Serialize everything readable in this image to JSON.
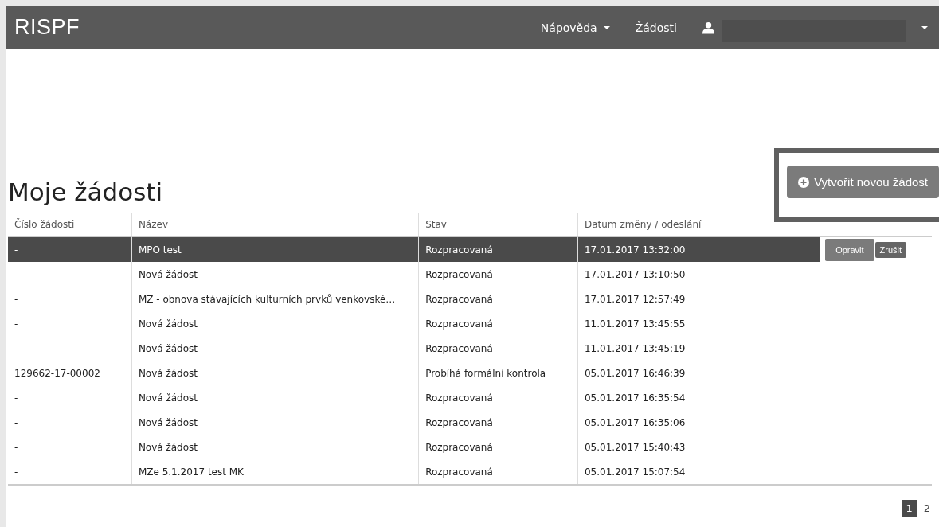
{
  "navbar": {
    "brand": "RISPF",
    "menu": [
      {
        "label": "Nápověda",
        "dropdown": true
      },
      {
        "label": "Žádosti",
        "dropdown": false
      }
    ],
    "user": {
      "redacted": true
    }
  },
  "page_title": "Moje žádosti",
  "create_button": "Vytvořit novou žádost",
  "table": {
    "columns": [
      "Číslo žádosti",
      "Název",
      "Stav",
      "Datum změny / odeslání"
    ],
    "rows": [
      {
        "number": "-",
        "name": "MPO test",
        "status": "Rozpracovaná",
        "date": "17.01.2017 13:32:00",
        "selected": true,
        "actions": [
          "Opravit",
          "Zrušit"
        ]
      },
      {
        "number": "-",
        "name": "Nová žádost",
        "status": "Rozpracovaná",
        "date": "17.01.2017 13:10:50",
        "selected": false
      },
      {
        "number": "-",
        "name": "MZ - obnova stávajících kulturních prvků venkovské…",
        "status": "Rozpracovaná",
        "date": "17.01.2017 12:57:49",
        "selected": false
      },
      {
        "number": "-",
        "name": "Nová žádost",
        "status": "Rozpracovaná",
        "date": "11.01.2017 13:45:55",
        "selected": false
      },
      {
        "number": "-",
        "name": "Nová žádost",
        "status": "Rozpracovaná",
        "date": "11.01.2017 13:45:19",
        "selected": false
      },
      {
        "number": "129662-17-00002",
        "name": "Nová žádost",
        "status": "Probíhá formální kontrola",
        "date": "05.01.2017 16:46:39",
        "selected": false
      },
      {
        "number": "-",
        "name": "Nová žádost",
        "status": "Rozpracovaná",
        "date": "05.01.2017 16:35:54",
        "selected": false
      },
      {
        "number": "-",
        "name": "Nová žádost",
        "status": "Rozpracovaná",
        "date": "05.01.2017 16:35:06",
        "selected": false
      },
      {
        "number": "-",
        "name": "Nová žádost",
        "status": "Rozpracovaná",
        "date": "05.01.2017 15:40:43",
        "selected": false
      },
      {
        "number": "-",
        "name": "MZe 5.1.2017 test MK",
        "status": "Rozpracovaná",
        "date": "05.01.2017 15:07:54",
        "selected": false
      }
    ]
  },
  "pagination": [
    {
      "label": "1",
      "selected": true
    },
    {
      "label": "2",
      "selected": false
    }
  ]
}
